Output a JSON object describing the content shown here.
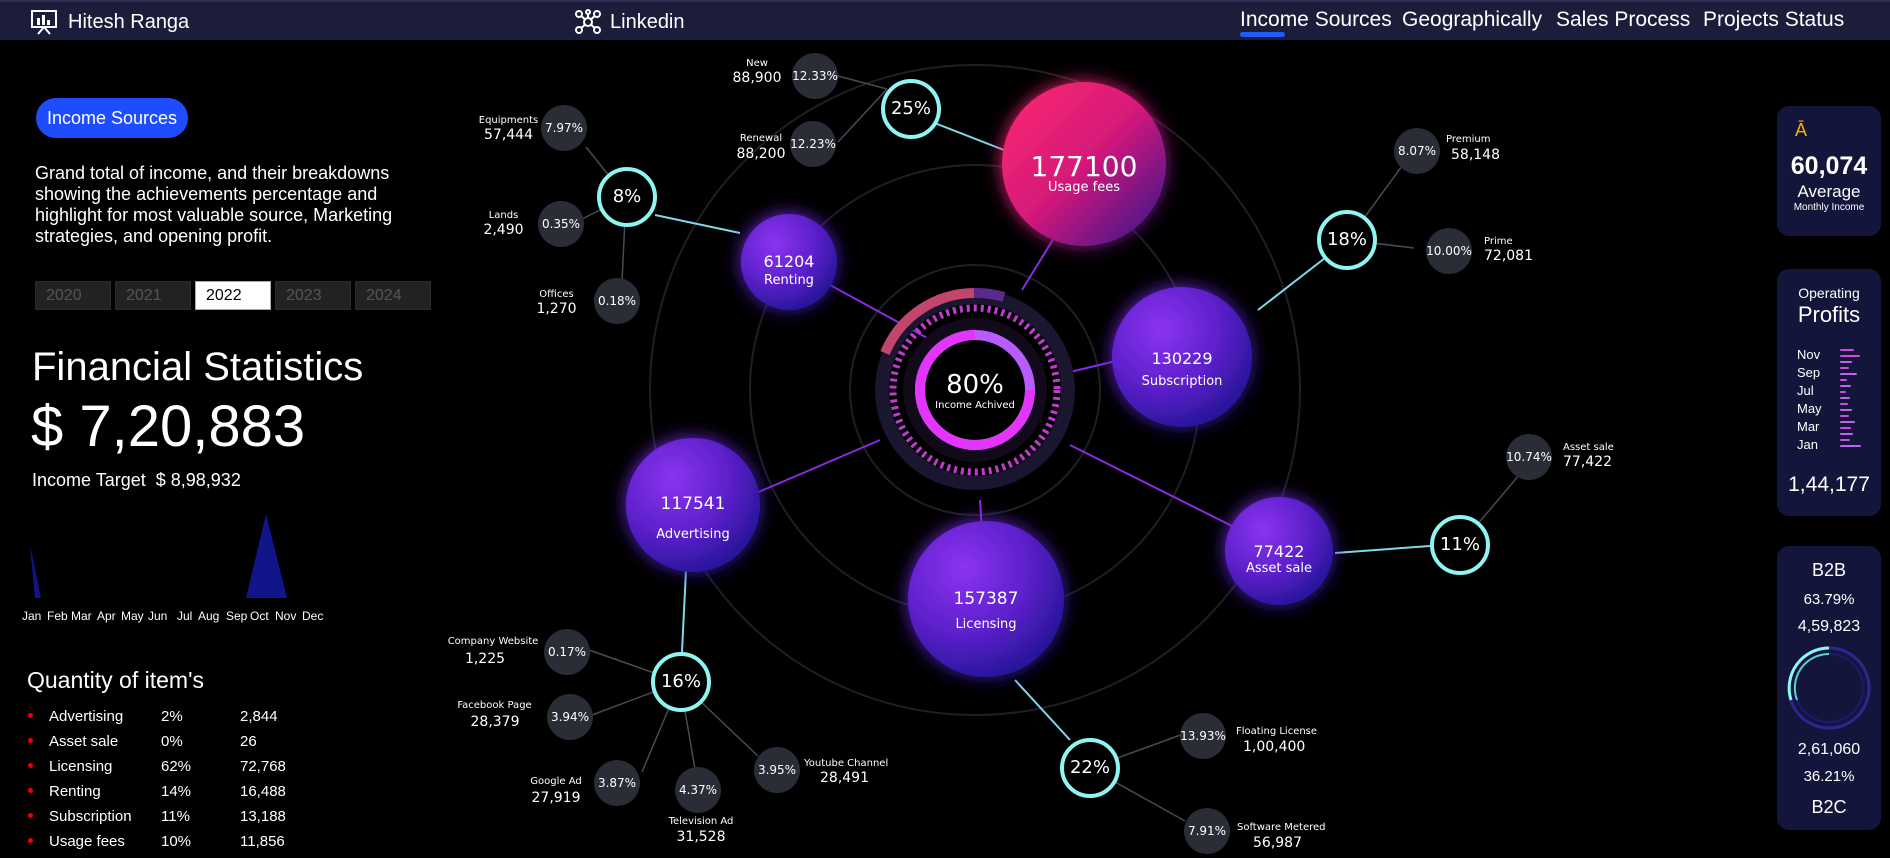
{
  "header": {
    "brand": "Hitesh Ranga",
    "linkedin": "Linkedin",
    "nav": [
      "Income Sources",
      "Geographically",
      "Sales Process",
      "Projects Status"
    ]
  },
  "sidebar": {
    "pill": "Income Sources",
    "description": "Grand total of income, and their breakdowns showing the achievements percentage and highlight for most valuable source, Marketing strategies, and opening profit.",
    "years": [
      "2020",
      "2021",
      "2022",
      "2023",
      "2024"
    ],
    "selected_year": "2022",
    "stats_title": "Financial Statistics",
    "stats_value": "$ 7,20,883",
    "target_label": "Income Target",
    "target_value": "$ 8,98,932",
    "months": [
      "Jan",
      "Feb",
      "Mar",
      "Apr",
      "May",
      "Jun",
      "Jul",
      "Aug",
      "Sep",
      "Oct",
      "Nov",
      "Dec"
    ],
    "qty_title": "Quantity of item's",
    "qty": [
      {
        "name": "Advertising",
        "pct": "2%",
        "value": "2,844"
      },
      {
        "name": "Asset sale",
        "pct": "0%",
        "value": "26"
      },
      {
        "name": "Licensing",
        "pct": "62%",
        "value": "72,768"
      },
      {
        "name": "Renting",
        "pct": "14%",
        "value": "16,488"
      },
      {
        "name": "Subscription",
        "pct": "11%",
        "value": "13,188"
      },
      {
        "name": "Usage fees",
        "pct": "10%",
        "value": "11,856"
      }
    ]
  },
  "center": {
    "pct": "80%",
    "label": "Income Achived",
    "achieved_fraction": 0.8
  },
  "bubbles": {
    "usage": {
      "value": "177100",
      "label": "Usage fees"
    },
    "renting": {
      "value": "61204",
      "label": "Renting"
    },
    "subscription": {
      "value": "130229",
      "label": "Subscription"
    },
    "advertising": {
      "value": "117541",
      "label": "Advertising"
    },
    "licensing": {
      "value": "157387",
      "label": "Licensing"
    },
    "asset": {
      "value": "77422",
      "label": "Asset sale"
    }
  },
  "rings": {
    "r25": "25%",
    "r8": "8%",
    "r18": "18%",
    "r11": "11%",
    "r16": "16%",
    "r22": "22%"
  },
  "details": {
    "new": {
      "name": "New",
      "value": "88,900",
      "pct": "12.33%"
    },
    "renewal": {
      "name": "Renewal",
      "value": "88,200",
      "pct": "12.23%"
    },
    "equipments": {
      "name": "Equipments",
      "value": "57,444",
      "pct": "7.97%"
    },
    "lands": {
      "name": "Lands",
      "value": "2,490",
      "pct": "0.35%"
    },
    "offices": {
      "name": "Offices",
      "value": "1,270",
      "pct": "0.18%"
    },
    "premium": {
      "name": "Premium",
      "value": "58,148",
      "pct": "8.07%"
    },
    "prime": {
      "name": "Prime",
      "value": "72,081",
      "pct": "10.00%"
    },
    "assetsale": {
      "name": "Asset sale",
      "value": "77,422",
      "pct": "10.74%"
    },
    "company": {
      "name": "Company Website",
      "value": "1,225",
      "pct": "0.17%"
    },
    "facebook": {
      "name": "Facebook Page",
      "value": "28,379",
      "pct": "3.94%"
    },
    "google": {
      "name": "Google Ad",
      "value": "27,919",
      "pct": "3.87%"
    },
    "television": {
      "name": "Television Ad",
      "value": "31,528",
      "pct": "4.37%"
    },
    "youtube": {
      "name": "Youtube Channel",
      "value": "28,491",
      "pct": "3.95%"
    },
    "floating": {
      "name": "Floating License",
      "value": "1,00,400",
      "pct": "13.93%"
    },
    "software": {
      "name": "Software Metered",
      "value": "56,987",
      "pct": "7.91%"
    }
  },
  "right": {
    "avg_glyph": "Ā",
    "avg_value": "60,074",
    "avg_label": "Average",
    "avg_sub": "Monthly Income",
    "op_label": "Operating",
    "op_title": "Profits",
    "op_months": [
      "Nov",
      "Sep",
      "Jul",
      "May",
      "Mar",
      "Jan"
    ],
    "op_total": "1,44,177",
    "b2b_label": "B2B",
    "b2b_pct": "63.79%",
    "b2b_value": "4,59,823",
    "b2c_value": "2,61,060",
    "b2c_pct": "36.21%",
    "b2c_label": "B2C",
    "b2b_fraction": 0.6379
  },
  "colors": {
    "accent_blue": "#1e4dff",
    "ring_cyan": "#8ff5f0",
    "bubble_purple": "#7a2ae0",
    "bubble_pink": "#ff2a6e",
    "small_circle": "#2a2d36"
  }
}
